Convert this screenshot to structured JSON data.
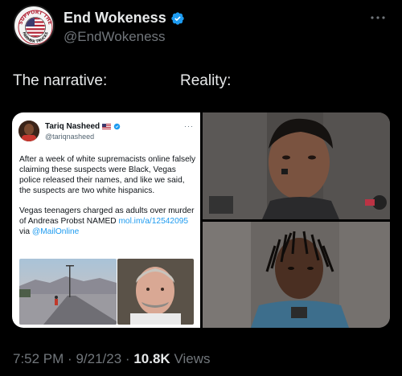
{
  "post": {
    "author": {
      "display_name": "End Wokeness",
      "handle": "@EndWokeness",
      "verified": true,
      "avatar_badge_top": "SUPPORT THE",
      "avatar_badge_bottom": "FARMER TRUCKS",
      "avatar_icon": "american-flag-badge"
    },
    "text_left": "The narrative:",
    "text_right": "Reality:",
    "time": "7:52 PM",
    "date": "9/21/23",
    "views_count": "10.8K",
    "views_label": "Views",
    "separator": "·"
  },
  "quoted": {
    "name": "Tariq Nasheed",
    "handle": "@tariqnasheed",
    "flag_icon": "us-flag",
    "more": "···",
    "para1": "After a week of white supremacists online falsely claiming these suspects were Black, Vegas police released their names, and like we said, the suspects are two white hispanics.",
    "para2_text": "Vegas teenagers charged as adults over murder of Andreas Probst NAMED ",
    "para2_link": "mol.im/a/12542095",
    "para2_via": " via ",
    "para2_mention": "@MailOnline"
  },
  "colors": {
    "background": "#000000",
    "text": "#e7e9ea",
    "secondary_text": "#71767b",
    "verified": "#1d9bf0",
    "link": "#1d9bf0"
  }
}
